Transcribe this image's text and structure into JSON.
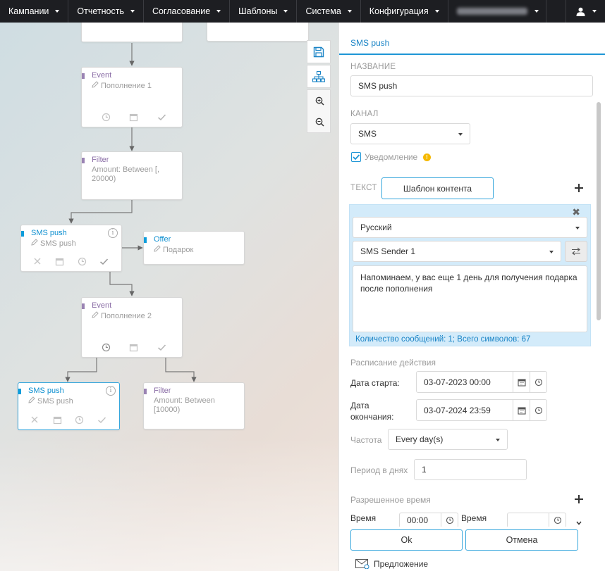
{
  "nav": {
    "items": [
      {
        "label": "Кампании"
      },
      {
        "label": "Отчетность"
      },
      {
        "label": "Согласование"
      },
      {
        "label": "Шаблоны"
      },
      {
        "label": "Система"
      },
      {
        "label": "Конфигурация"
      }
    ],
    "user_icon": "user-icon"
  },
  "flow": {
    "nodes": [
      {
        "type": "Event",
        "sub": "Пополнение 1"
      },
      {
        "type": "Filter",
        "sub": "Amount: Between [, 20000)"
      },
      {
        "type": "SMS push",
        "sub": "SMS push"
      },
      {
        "type": "Offer",
        "sub": "Подарок"
      },
      {
        "type": "Event",
        "sub": "Пополнение 2"
      },
      {
        "type": "SMS push",
        "sub": "SMS push"
      },
      {
        "type": "Filter",
        "sub": "Amount: Between [10000)"
      }
    ]
  },
  "toolbar": {
    "icons": [
      "save-icon",
      "hierarchy-icon",
      "zoom-in-icon",
      "zoom-out-icon"
    ]
  },
  "panel": {
    "title": "SMS push",
    "name_label": "НАЗВАНИЕ",
    "name_value": "SMS push",
    "channel_label": "КАНАЛ",
    "channel_value": "SMS",
    "notify_label": "Уведомление",
    "text_label": "ТЕКСТ",
    "template_button": "Шаблон контента",
    "language": "Русский",
    "sender": "SMS Sender 1",
    "message": "Напоминаем, у вас еще 1 день для получения подарка после пополнения",
    "message_count": "Количество сообщений: 1; Всего символов: 67",
    "schedule_label": "Расписание действия",
    "start_label": "Дата старта:",
    "start_value": "03-07-2023 00:00",
    "end_label_line1": "Дата",
    "end_label_line2": "окончания:",
    "end_value": "03-07-2024 23:59",
    "freq_label": "Частота",
    "freq_value": "Every day(s)",
    "period_label": "Период в днях",
    "period_value": "1",
    "allowed_label": "Разрешенное время",
    "time_label_1": "Время",
    "time_value_1": "00:00",
    "time_label_2": "Время",
    "ok": "Ok",
    "cancel": "Отмена",
    "offer_label": "Предложение"
  }
}
